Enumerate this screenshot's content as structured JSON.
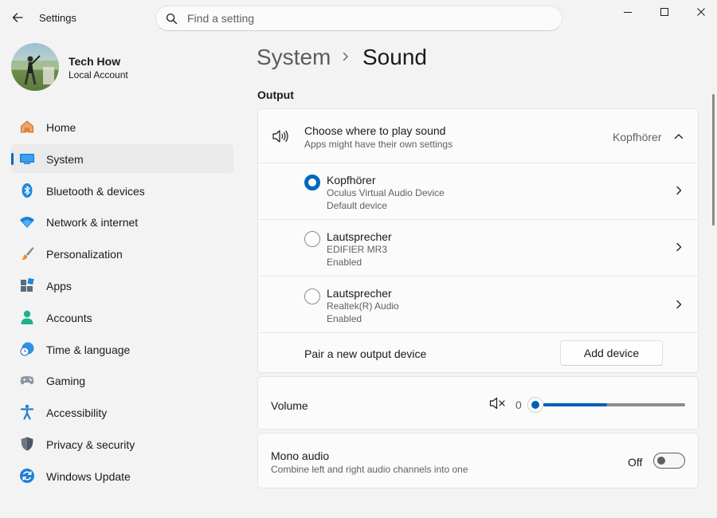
{
  "window": {
    "app_title": "Settings"
  },
  "search": {
    "placeholder": "Find a setting"
  },
  "profile": {
    "name": "Tech How",
    "account_type": "Local Account"
  },
  "sidebar": {
    "items": [
      {
        "label": "Home",
        "icon": "home-icon"
      },
      {
        "label": "System",
        "icon": "system-icon",
        "active": true
      },
      {
        "label": "Bluetooth & devices",
        "icon": "bluetooth-icon"
      },
      {
        "label": "Network & internet",
        "icon": "wifi-icon"
      },
      {
        "label": "Personalization",
        "icon": "brush-icon"
      },
      {
        "label": "Apps",
        "icon": "apps-icon"
      },
      {
        "label": "Accounts",
        "icon": "accounts-icon"
      },
      {
        "label": "Time & language",
        "icon": "clock-globe-icon"
      },
      {
        "label": "Gaming",
        "icon": "gamepad-icon"
      },
      {
        "label": "Accessibility",
        "icon": "accessibility-icon"
      },
      {
        "label": "Privacy & security",
        "icon": "shield-icon"
      },
      {
        "label": "Windows Update",
        "icon": "update-icon"
      }
    ]
  },
  "breadcrumb": {
    "parent": "System",
    "current": "Sound"
  },
  "output": {
    "section_title": "Output",
    "choose": {
      "title": "Choose where to play sound",
      "subtitle": "Apps might have their own settings",
      "current_value": "Kopfhörer"
    },
    "devices": [
      {
        "name": "Kopfhörer",
        "description": "Oculus Virtual Audio Device",
        "status": "Default device",
        "selected": true
      },
      {
        "name": "Lautsprecher",
        "description": "EDIFIER MR3",
        "status": "Enabled",
        "selected": false
      },
      {
        "name": "Lautsprecher",
        "description": "Realtek(R) Audio",
        "status": "Enabled",
        "selected": false
      }
    ],
    "pair": {
      "label": "Pair a new output device",
      "button_label": "Add device"
    }
  },
  "volume": {
    "label": "Volume",
    "value": "0",
    "slider_fill_fraction": 0.45
  },
  "mono_audio": {
    "title": "Mono audio",
    "subtitle": "Combine left and right audio channels into one",
    "state_label": "Off",
    "enabled": false
  },
  "colors": {
    "accent": "#0067c0",
    "window_background": "#f3f3f3",
    "card_background": "#fbfbfb"
  }
}
